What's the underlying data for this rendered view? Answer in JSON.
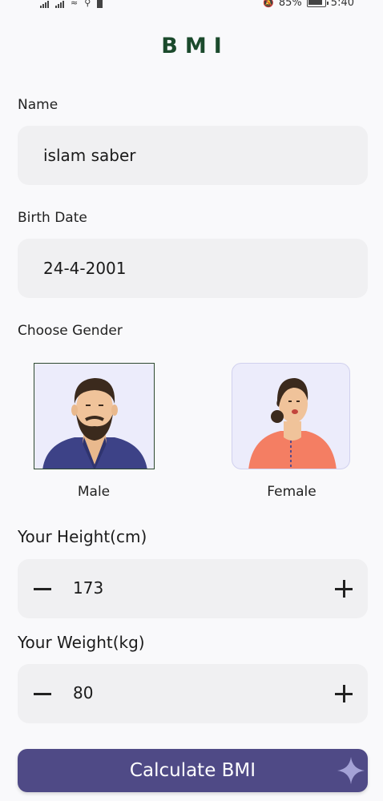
{
  "status_bar": {
    "battery_percent": "85%",
    "time": "5:40"
  },
  "header": {
    "title": "BMI"
  },
  "form": {
    "name_label": "Name",
    "name_value": "islam saber",
    "birth_date_label": "Birth Date",
    "birth_date_value": "24-4-2001",
    "gender_label": "Choose Gender",
    "genders": [
      {
        "label": "Male",
        "selected": true
      },
      {
        "label": "Female",
        "selected": false
      }
    ],
    "height_label": "Your Height(cm)",
    "height_value": "173",
    "weight_label": "Your Weight(kg)",
    "weight_value": "80"
  },
  "actions": {
    "calculate_label": "Calculate BMI"
  },
  "colors": {
    "title": "#1b4a2c",
    "accent": "#4f4a86",
    "field_bg": "#f0f0f2",
    "card_bg": "#ececfb",
    "selected_border": "#2e4a30"
  }
}
